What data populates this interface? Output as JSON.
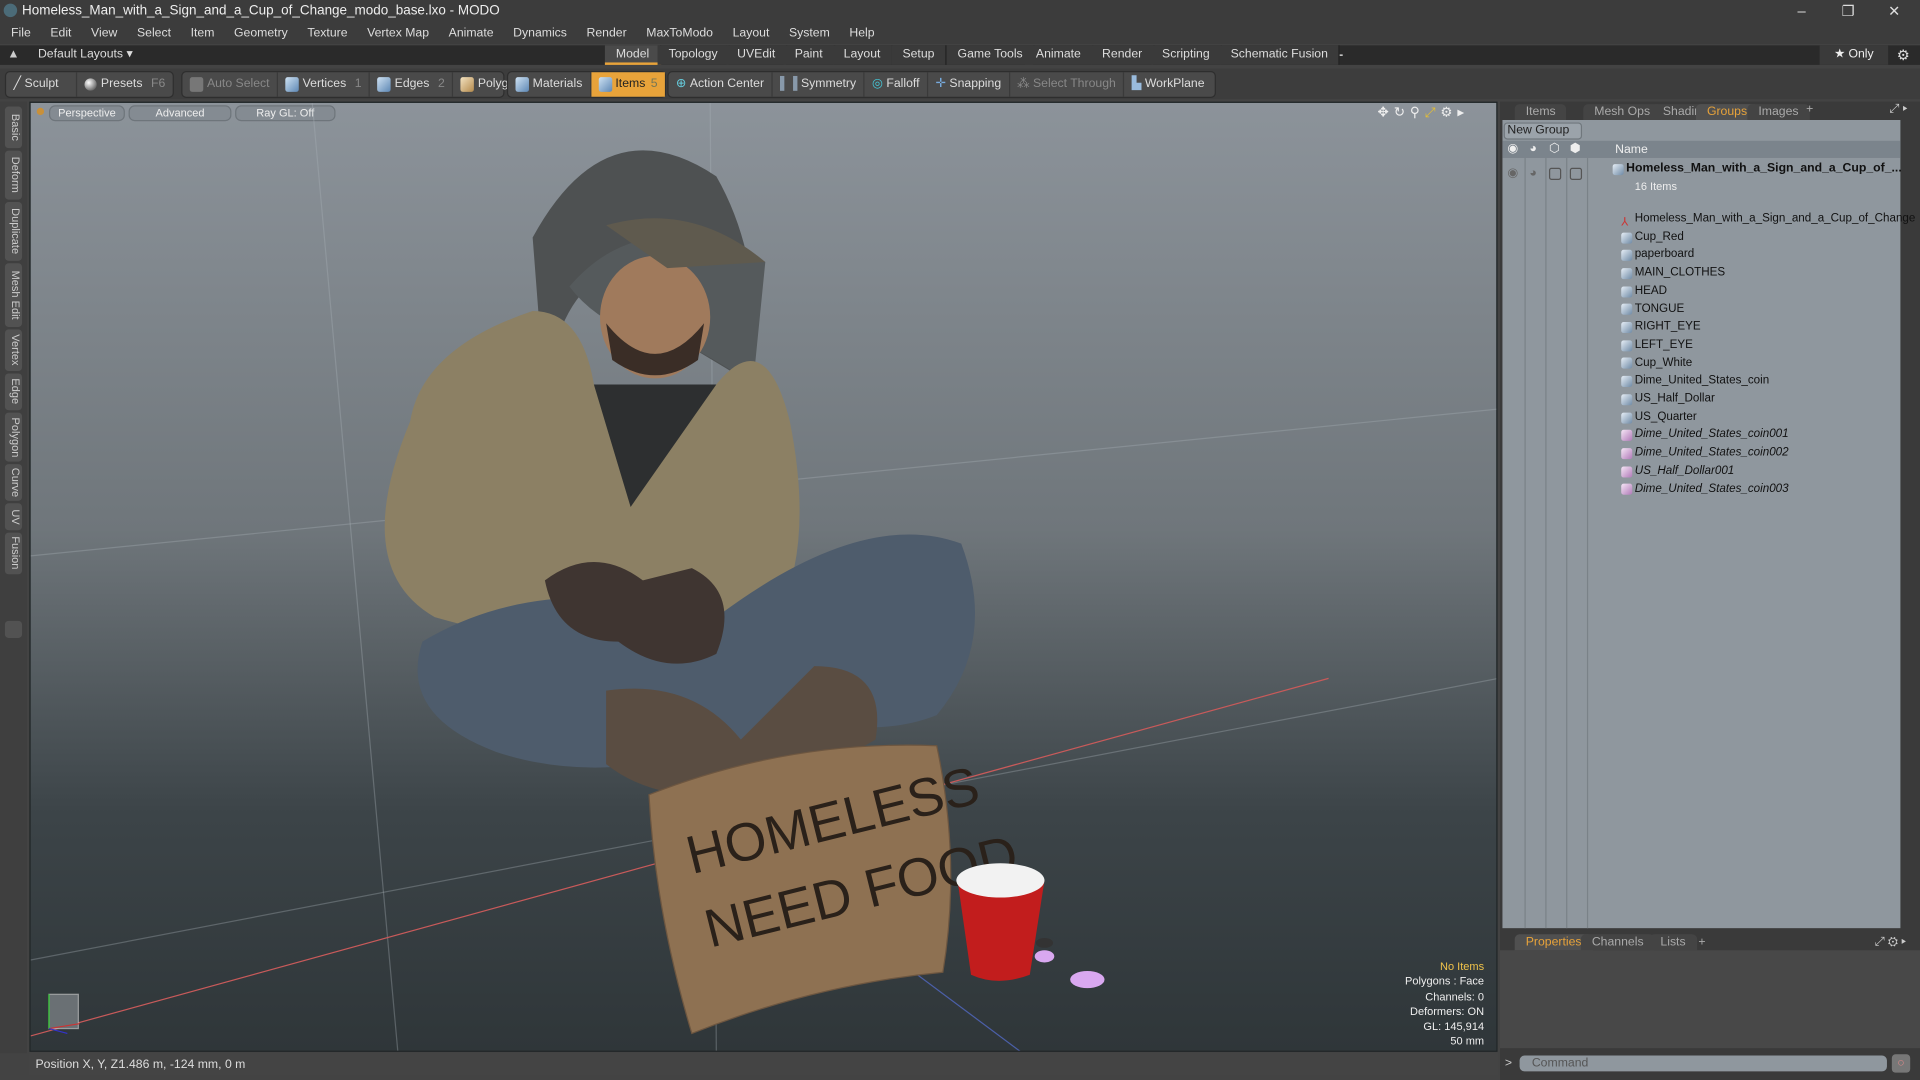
{
  "window": {
    "title": "Homeless_Man_with_a_Sign_and_a_Cup_of_Change_modo_base.lxo - MODO",
    "minimize": "–",
    "restore": "❐",
    "close": "✕"
  },
  "menu": [
    "File",
    "Edit",
    "View",
    "Select",
    "Item",
    "Geometry",
    "Texture",
    "Vertex Map",
    "Animate",
    "Dynamics",
    "Render",
    "MaxToModo",
    "Layout",
    "System",
    "Help"
  ],
  "layouts": {
    "label": "Default Layouts ▾",
    "tabs": [
      "Model",
      "Topology",
      "UVEdit",
      "Paint",
      "Layout",
      "Setup",
      "Game Tools",
      "Animate",
      "Render",
      "Scripting",
      "Schematic Fusion"
    ],
    "active": "Model",
    "add": "+",
    "only": "★ Only"
  },
  "toolbar": {
    "sculpt": "Sculpt",
    "presets": "Presets",
    "presets_key": "F6",
    "auto_select": "Auto Select",
    "vertices": "Vertices",
    "vertices_key": "1",
    "edges": "Edges",
    "edges_key": "2",
    "polygons": "Polygons",
    "materials": "Materials",
    "items": "Items",
    "items_key": "5",
    "action_center": "Action Center",
    "symmetry": "Symmetry",
    "falloff": "Falloff",
    "snapping": "Snapping",
    "select_through": "Select Through",
    "workplane": "WorkPlane"
  },
  "left_tabs": [
    "Basic",
    "Deform",
    "Duplicate",
    "Mesh Edit",
    "Vertex",
    "Edge",
    "Polygon",
    "Curve",
    "UV",
    "Fusion"
  ],
  "viewport": {
    "view": "Perspective",
    "shading": "Advanced",
    "raygl": "Ray GL: Off",
    "sign_text": "HOMELESS NEED FOOD",
    "info": {
      "selection": "No Items",
      "polygons": "Polygons : Face",
      "channels": "Channels: 0",
      "deformers": "Deformers: ON",
      "gl": "GL: 145,914",
      "focal": "50 mm"
    }
  },
  "status": {
    "position_label": "Position X, Y, Z:",
    "position_value": "1.486 m, -124 mm, 0 m"
  },
  "right_panel": {
    "tabs": [
      "Items",
      "Mesh Ops",
      "Shading",
      "Groups",
      "Images"
    ],
    "active": "Groups",
    "add": "+",
    "new_group": "New Group",
    "name_header": "Name",
    "group": {
      "name": "Homeless_Man_with_a_Sign_and_a_Cup_of_...",
      "count": "16 Items"
    },
    "items": [
      {
        "name": "Homeless_Man_with_a_Sign_and_a_Cup_of_Change",
        "type": "locator"
      },
      {
        "name": "Cup_Red",
        "type": "mesh"
      },
      {
        "name": "paperboard",
        "type": "mesh"
      },
      {
        "name": "MAIN_CLOTHES",
        "type": "mesh"
      },
      {
        "name": "HEAD",
        "type": "mesh"
      },
      {
        "name": "TONGUE",
        "type": "mesh"
      },
      {
        "name": "RIGHT_EYE",
        "type": "mesh"
      },
      {
        "name": "LEFT_EYE",
        "type": "mesh"
      },
      {
        "name": "Cup_White",
        "type": "mesh"
      },
      {
        "name": "Dime_United_States_coin",
        "type": "mesh"
      },
      {
        "name": "US_Half_Dollar",
        "type": "mesh"
      },
      {
        "name": "US_Quarter",
        "type": "mesh"
      },
      {
        "name": "Dime_United_States_coin001",
        "type": "instance"
      },
      {
        "name": "Dime_United_States_coin002",
        "type": "instance"
      },
      {
        "name": "US_Half_Dollar001",
        "type": "instance"
      },
      {
        "name": "Dime_United_States_coin003",
        "type": "instance"
      }
    ]
  },
  "bottom_panel": {
    "tabs": [
      "Properties",
      "Channels",
      "Lists"
    ],
    "active": "Properties",
    "add": "+",
    "command_placeholder": "Command",
    "prompt": ">"
  },
  "colors": {
    "accent": "#e8a33a",
    "outliner_bg": "#8f979e"
  }
}
